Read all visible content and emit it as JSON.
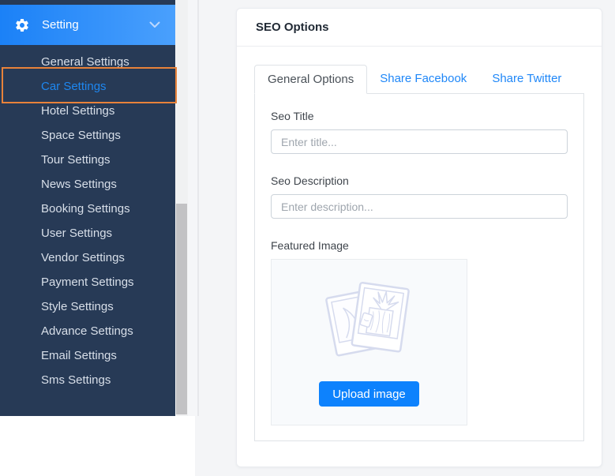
{
  "sidebar": {
    "header": {
      "label": "Setting"
    },
    "items": [
      {
        "label": "General Settings",
        "active": false
      },
      {
        "label": "Car Settings",
        "active": true,
        "highlighted": true
      },
      {
        "label": "Hotel Settings",
        "active": false
      },
      {
        "label": "Space Settings",
        "active": false
      },
      {
        "label": "Tour Settings",
        "active": false
      },
      {
        "label": "News Settings",
        "active": false
      },
      {
        "label": "Booking Settings",
        "active": false
      },
      {
        "label": "User Settings",
        "active": false
      },
      {
        "label": "Vendor Settings",
        "active": false
      },
      {
        "label": "Payment Settings",
        "active": false
      },
      {
        "label": "Style Settings",
        "active": false
      },
      {
        "label": "Advance Settings",
        "active": false
      },
      {
        "label": "Email Settings",
        "active": false
      },
      {
        "label": "Sms Settings",
        "active": false
      }
    ]
  },
  "main": {
    "card_title": "SEO Options",
    "tabs": [
      {
        "label": "General Options",
        "active": true
      },
      {
        "label": "Share Facebook",
        "active": false
      },
      {
        "label": "Share Twitter",
        "active": false
      }
    ],
    "form": {
      "seo_title_label": "Seo Title",
      "seo_title_placeholder": "Enter title...",
      "seo_title_value": "",
      "seo_description_label": "Seo Description",
      "seo_description_placeholder": "Enter description...",
      "seo_description_value": "",
      "featured_image_label": "Featured Image",
      "upload_button_label": "Upload image"
    }
  },
  "colors": {
    "sidebar_bg": "#273a56",
    "sidebar_text": "#d8dfe9",
    "active_item_text": "#1e87f0",
    "highlight_border": "#e8823a",
    "header_gradient_start": "#1b81f7",
    "header_gradient_end": "#4aa0fd",
    "tab_link_blue": "#1f87f8",
    "upload_button_bg": "#0d82fd",
    "content_bg": "#f4f5f7",
    "scroll_thumb": "#c2c2c4"
  }
}
